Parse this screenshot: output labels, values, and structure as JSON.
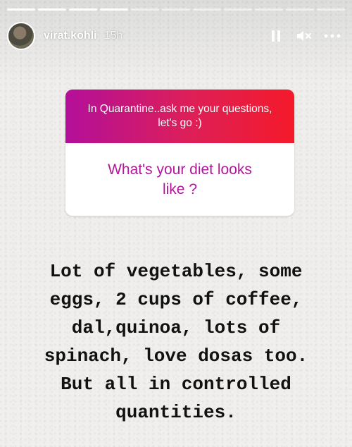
{
  "story": {
    "progress_total": 11,
    "progress_completed": 4,
    "username": "virat.kohli",
    "time": "15h",
    "icons": {
      "avatar": "profile-photo",
      "pause": "pause-icon",
      "mute": "mute-icon",
      "more": "more-options-icon"
    }
  },
  "card": {
    "prompt": "In Quarantine..ask me your questions,\nlet's go :)",
    "question": "What's your diet looks\nlike ?",
    "colors": {
      "gradient_start": "#b30f9a",
      "gradient_end": "#f41a2a",
      "question_text": "#b0179b"
    }
  },
  "answer": {
    "text": "Lot of vegetables, some\neggs, 2 cups of coffee,\ndal,quinoa, lots of\nspinach, love dosas too.\nBut all in controlled\nquantities."
  }
}
